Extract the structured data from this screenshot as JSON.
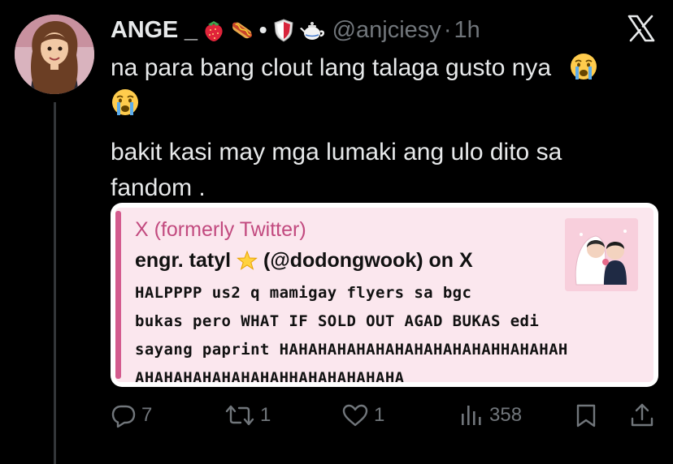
{
  "tweet": {
    "display_name": "ANGE _",
    "name_separator": "•",
    "handle": "@anjciesy",
    "time_separator": "·",
    "time": "1h",
    "text_line1": "na para bang clout lang talaga gusto nya",
    "text_line2": "bakit kasi may mga lumaki ang ulo dito sa fandom .",
    "emojis": [
      "strawberry-icon",
      "hotdog-icon",
      "shield-icon",
      "teapot-icon",
      "crying-face-icon"
    ]
  },
  "quote_card": {
    "source": "X (formerly Twitter)",
    "title_name": "engr. tatyl",
    "title_handle": "(@dodongwook) on X",
    "body_lines": [
      "HALPPPP us2 q mamigay flyers sa bgc",
      "bukas pero WHAT IF SOLD OUT AGAD BUKAS edi",
      "sayang paprint HAHAHAHAHAHAHAHAHAHAHAHHAHAHAH",
      "AHAHAHAHAHAHAHAHHAHAHAHAHAHA"
    ],
    "accent_color": "#d45b8e",
    "background_color": "#fbe7ee"
  },
  "actions": {
    "reply_count": "7",
    "retweet_count": "1",
    "like_count": "1",
    "view_count": "358"
  },
  "colors": {
    "background": "#000000",
    "text": "#e7e9ea",
    "secondary": "#71767b"
  }
}
